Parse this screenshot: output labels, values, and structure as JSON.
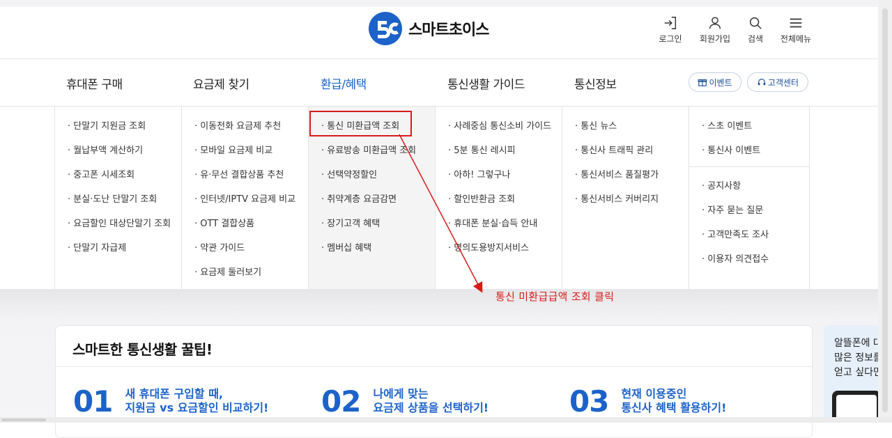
{
  "brand": {
    "name": "스마트초이스"
  },
  "utility": {
    "login": "로그인",
    "signup": "회원가입",
    "search": "검색",
    "menu": "전체메뉴"
  },
  "gnb": {
    "items": [
      "휴대폰 구매",
      "요금제 찾기",
      "환급/혜택",
      "통신생활 가이드",
      "통신정보"
    ],
    "active_index": 2,
    "event_label": "이벤트",
    "support_label": "고객센터"
  },
  "mega_menu": {
    "col1": [
      "단말기 지원금 조회",
      "월납부액 계산하기",
      "중고폰 시세조회",
      "분실·도난 단말기 조회",
      "요금할인 대상단말기 조회",
      "단말기 자급제"
    ],
    "col2": [
      "이동전화 요금제 추천",
      "모바일 요금제 비교",
      "유·무선 결합상품 추천",
      "인터넷/IPTV 요금제 비교",
      "OTT 결합상품",
      "약관 가이드",
      "요금제 둘러보기"
    ],
    "col3": [
      "통신 미환급액 조회",
      "유료방송 미환급액 조회",
      "선택약정할인",
      "취약계층 요금감면",
      "장기고객 혜택",
      "멤버십 혜택"
    ],
    "col4": [
      "사례중심 통신소비 가이드",
      "5분 통신 레시피",
      "아하! 그렇구나",
      "할인반환금 조회",
      "휴대폰 분실·습득 안내",
      "명의도용방지서비스"
    ],
    "col5": [
      "통신 뉴스",
      "통신사 트래픽 관리",
      "통신서비스 품질평가",
      "통신서비스 커버리지"
    ],
    "col6_top": [
      "스초 이벤트",
      "통신사 이벤트"
    ],
    "col6_bottom": [
      "공지사항",
      "자주 묻는 질문",
      "고객만족도 조사",
      "이용자 의견접수"
    ]
  },
  "annotation": {
    "text": "통신 미환급급액 조회 클릭"
  },
  "tips": {
    "title": "스마트한 통신생활 꿀팁!",
    "items": [
      {
        "num": "01",
        "line1": "새 휴대폰 구입할 때,",
        "line2": "지원금 vs 요금할인 비교하기!"
      },
      {
        "num": "02",
        "line1": "나에게 맞는",
        "line2": "요금제 상품을 선택하기!"
      },
      {
        "num": "03",
        "line1": "현재 이용중인",
        "line2": "통신사 혜택 활용하기!"
      }
    ]
  },
  "side_banner": {
    "line1": "알뜰폰에 대",
    "line2": "많은 정보를",
    "line3": "얻고 싶다면"
  },
  "colors": {
    "accent": "#1c62c9",
    "annotation": "#d81b1b"
  }
}
